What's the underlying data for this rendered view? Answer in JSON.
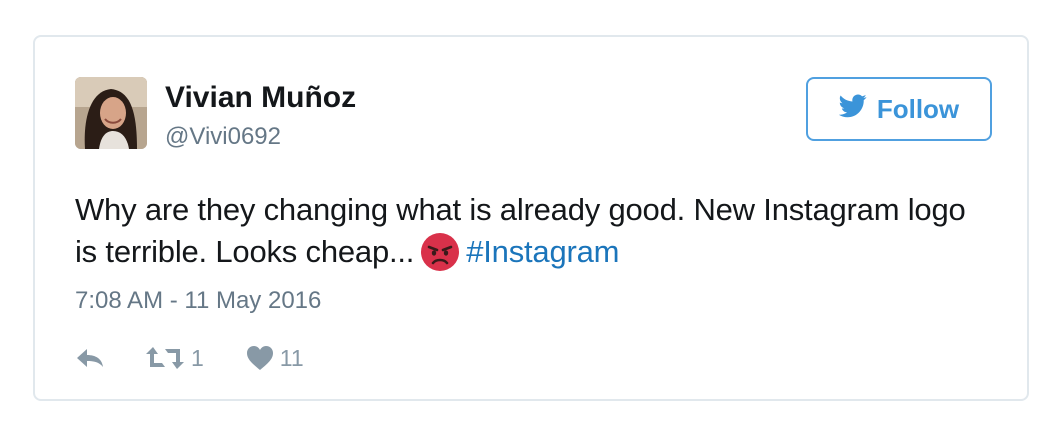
{
  "user": {
    "name": "Vivian Muñoz",
    "handle": "@Vivi0692"
  },
  "follow_button": {
    "label": "Follow"
  },
  "tweet": {
    "text": "Why are they changing what is already good. New Instagram logo is terrible. Looks cheap...",
    "emoji": "angry-face-emoji",
    "hashtag": "#Instagram",
    "timestamp": "7:08 AM - 11 May 2016"
  },
  "actions": {
    "retweet_count": "1",
    "like_count": "11"
  },
  "colors": {
    "border": "#e1e8ed",
    "twitter_blue": "#3b94d9",
    "link": "#1b75bb",
    "muted": "#657786",
    "icon": "#8899a6"
  }
}
